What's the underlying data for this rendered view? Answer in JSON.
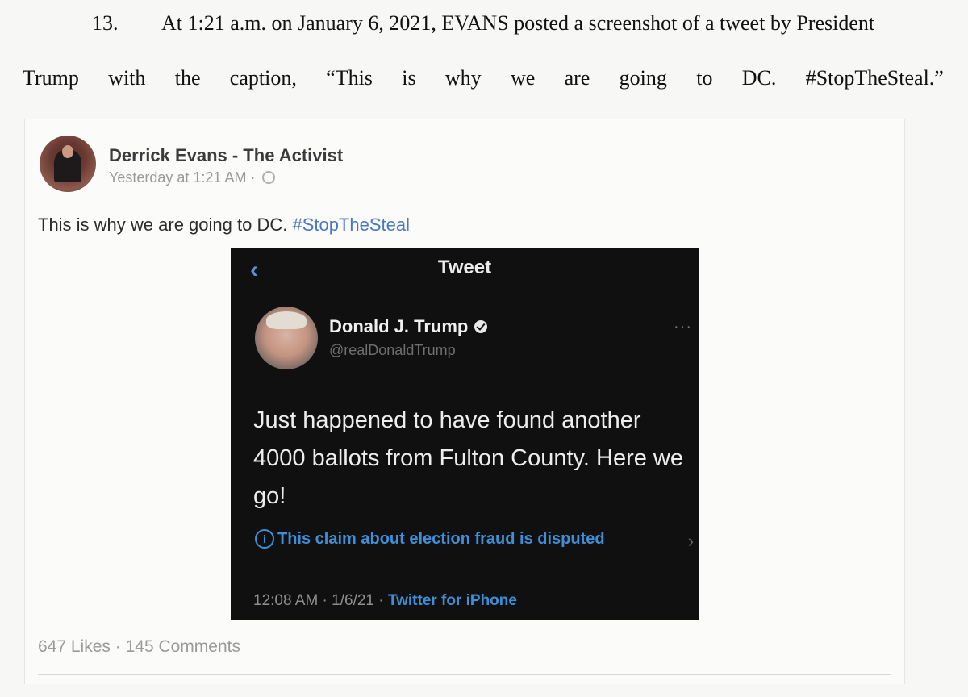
{
  "document": {
    "paragraph_number": "13.",
    "line1": "At 1:21 a.m. on January 6, 2021, EVANS posted a screenshot of a tweet by President",
    "line2_words": [
      "Trump",
      "with",
      "the",
      "caption,",
      "“This",
      "is",
      "why",
      "we",
      "are",
      "going",
      "to",
      "DC.",
      "#StopTheSteal.”"
    ]
  },
  "facebook_post": {
    "author": "Derrick Evans - The Activist",
    "timestamp": "Yesterday at 1:21 AM ·",
    "text": "This is why we are going to DC.",
    "hashtag": "#StopTheSteal",
    "likes": "647 Likes",
    "separator": "·",
    "comments": "145 Comments",
    "icons": {
      "privacy": "globe-icon"
    }
  },
  "tweet_screenshot": {
    "back_glyph": "‹",
    "header": "Tweet",
    "author_name": "Donald J. Trump",
    "handle": "@realDonaldTrump",
    "body": "Just happened to have found another 4000 ballots from Fulton County. Here we go!",
    "disputed_notice": "This claim about election fraud is disputed",
    "time": "12:08 AM · 1/6/21 ·",
    "client": "Twitter for iPhone",
    "icons": {
      "back": "chevron-left-icon",
      "verified": "verified-badge-icon",
      "info": "info-icon",
      "more": "more-dots-icon",
      "chevron": "chevron-right-icon"
    }
  },
  "colors": {
    "hashtag": "#4a78c2",
    "tweet_background": "#101010",
    "twitter_blue": "#3f8fd8"
  }
}
